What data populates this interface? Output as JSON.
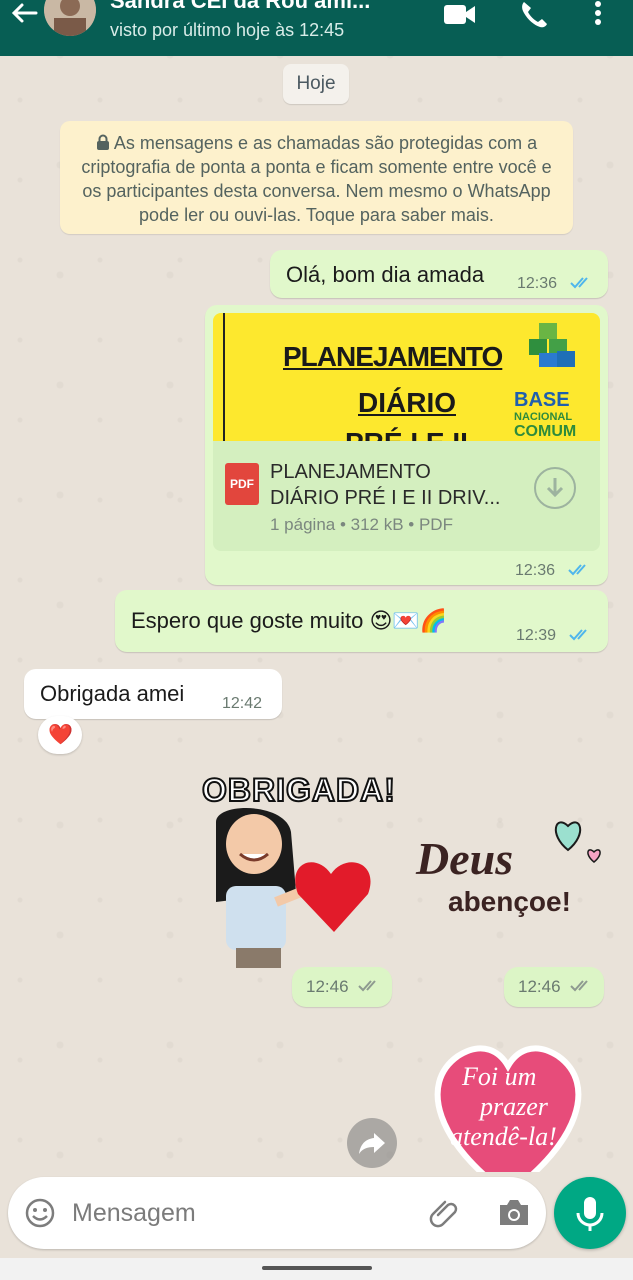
{
  "header": {
    "contact_name": "Sandra CEI da Rou ami...",
    "last_seen": "visto por último hoje às 12:45"
  },
  "date_chip": "Hoje",
  "encryption_notice": "As mensagens e as chamadas são protegidas com a criptografia de ponta a ponta e ficam somente entre você e os participantes desta conversa. Nem mesmo o WhatsApp pode ler ou ouvi-las. Toque para saber mais.",
  "messages": [
    {
      "text": "Olá, bom dia amada",
      "time": "12:36"
    },
    {
      "document": {
        "preview_lines": [
          "PLANEJAMENTO",
          "DIÁRIO",
          "PRÉ I E II"
        ],
        "preview_logo": [
          "BASE",
          "NACIONAL",
          "COMUM"
        ],
        "name_line1": "PLANEJAMENTO",
        "name_line2": "DIÁRIO PRÉ I E II DRIV...",
        "meta": "1 página • 312 kB • PDF",
        "badge": "PDF"
      },
      "time": "12:36"
    },
    {
      "text": "Espero que goste muito 😍💌🌈",
      "time": "12:39"
    },
    {
      "text": "Obrigada amei",
      "time": "12:42",
      "reaction": "❤️"
    },
    {
      "sticker_text": "OBRIGADA!",
      "time": "12:46"
    },
    {
      "sticker_text_1": "Deus",
      "sticker_text_2": "abençoe!",
      "time": "12:46"
    },
    {
      "sticker_text_1": "Foi um",
      "sticker_text_2": "prazer",
      "sticker_text_3": "atendê-la!"
    }
  ],
  "composer": {
    "placeholder": "Mensagem"
  },
  "colors": {
    "header": "#075e54",
    "outgoing": "#e1f8cb",
    "incoming": "#ffffff",
    "read_ticks": "#4fb6ec",
    "accent": "#00a884"
  }
}
